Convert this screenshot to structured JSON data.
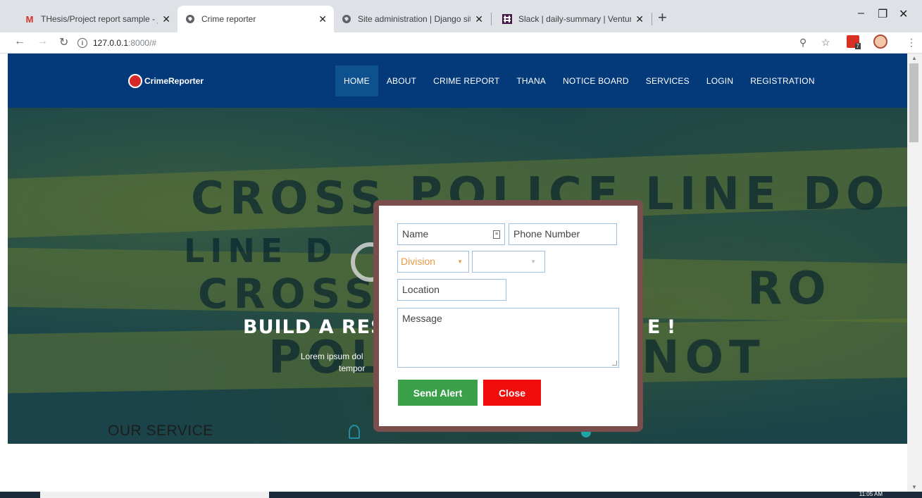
{
  "browser": {
    "tabs": [
      {
        "title": "THesis/Project report sample - ju",
        "icon": "gmail-icon",
        "active": false
      },
      {
        "title": "Crime reporter",
        "icon": "globe-icon",
        "active": true
      },
      {
        "title": "Site administration | Django site",
        "icon": "globe-icon",
        "active": false
      },
      {
        "title": "Slack | daily-summary | Venture S",
        "icon": "slack-icon",
        "active": false
      }
    ],
    "url_host": "127.0.0.1",
    "url_path": ":8000/#",
    "extension_badge": "7"
  },
  "site": {
    "logo_text": "CrimeReporter",
    "menu": [
      "HOME",
      "ABOUT",
      "CRIME REPORT",
      "THANA",
      "NOTICE BOARD",
      "SERVICES",
      "LOGIN",
      "REGISTRATION"
    ],
    "active_menu": "HOME"
  },
  "hero": {
    "tape_texts": [
      "CROSS",
      "POLICE LINE DO NO",
      "LINE D",
      "CROSS",
      "POL",
      "NOT",
      "RO"
    ],
    "headline": "BUILD A RES",
    "headline_end": "E !",
    "subtext_line1": "Lorem ipsum dol",
    "subtext_line2": "tempor"
  },
  "modal": {
    "name_placeholder": "Name",
    "phone_placeholder": "Phone Number",
    "division_placeholder": "Division",
    "second_select_value": "",
    "location_placeholder": "Location",
    "message_placeholder": "Message",
    "send_label": "Send Alert",
    "close_label": "Close",
    "colors": {
      "send": "#3aa04a",
      "close": "#f30c0c",
      "frame": "#7b4e4e",
      "field_border": "#9cc0e3"
    }
  },
  "services": {
    "title": "OUR SERVICE"
  },
  "taskbar": {
    "time": "11:05 AM"
  },
  "colors": {
    "nav_bg": "#053a7a",
    "nav_active": "#0d528f",
    "hero_bg": "#1a4449"
  }
}
